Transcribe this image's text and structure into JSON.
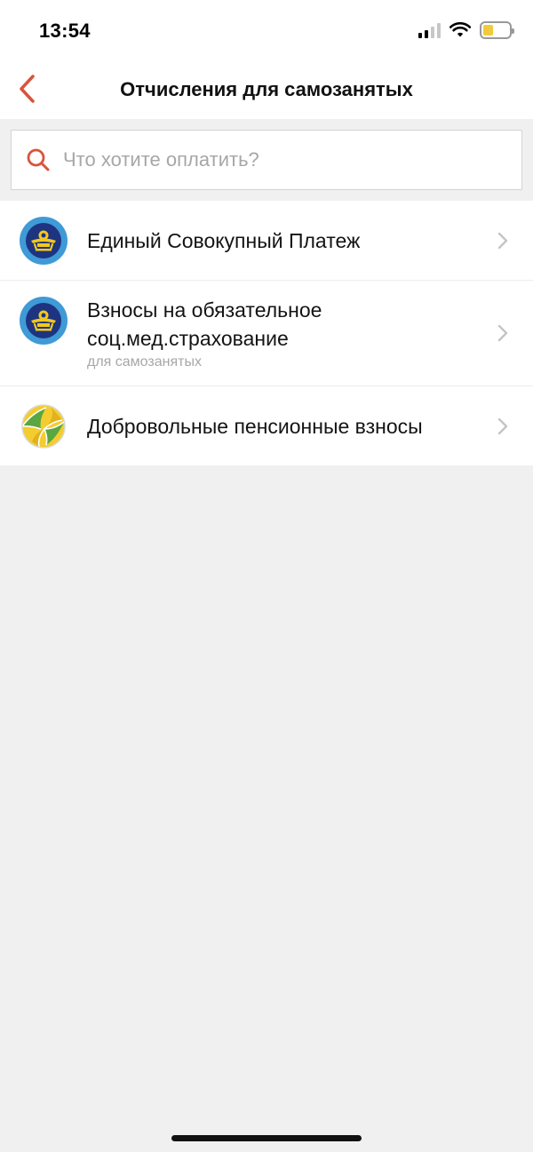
{
  "status_bar": {
    "time": "13:54",
    "signal_color": "#000000",
    "signal_dim_color": "#c7c7c7",
    "battery_color": "#f2cb3b"
  },
  "nav": {
    "title": "Отчисления для самозанятых",
    "back_icon": "chevron-left-icon",
    "accent_color": "#d9533b"
  },
  "search": {
    "placeholder": "Что хотите оплатить?",
    "value": "",
    "icon": "search-icon"
  },
  "items": [
    {
      "title": "Единый Совокупный Платеж",
      "subtitle": "",
      "icon": "state-emblem-icon"
    },
    {
      "title": "Взносы на обязательное соц.мед.страхование",
      "subtitle": "для самозанятых",
      "icon": "state-emblem-icon"
    },
    {
      "title": "Добровольные пенсионные взносы",
      "subtitle": "",
      "icon": "pension-fund-logo-icon"
    }
  ]
}
